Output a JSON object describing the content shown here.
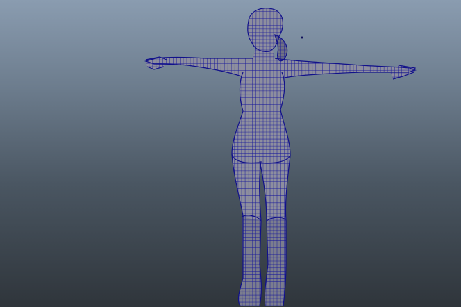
{
  "viewport": {
    "background_top": "#8a9cb0",
    "background_bottom": "#2f353b",
    "wire_color": "#1a1a9a",
    "mesh_color": "#8d8e9e",
    "display_mode": "wireframe-on-shaded",
    "pose": "t-pose"
  }
}
